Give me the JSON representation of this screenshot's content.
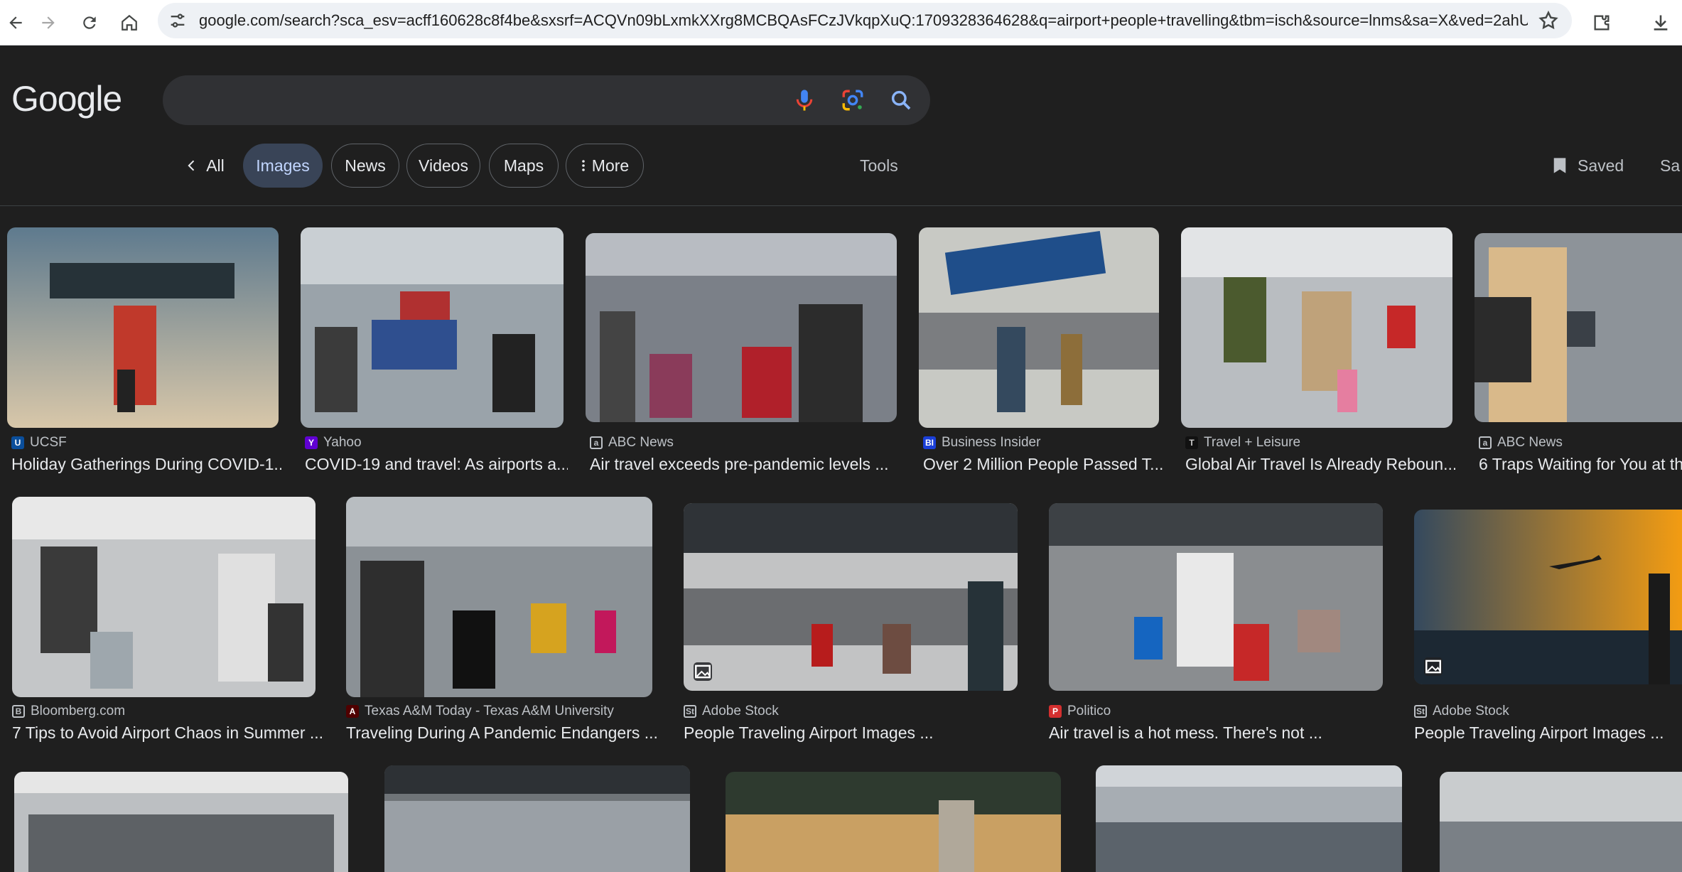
{
  "browser": {
    "url": "google.com/search?sca_esv=acff160628c8f4be&sxsrf=ACQVn09bLxmkXXrg8MCBQAsFCzJVkqpXuQ:1709328364628&q=airport+people+travelling&tbm=isch&source=lnms&sa=X&ved=2ahU..."
  },
  "header": {
    "logo": "Google",
    "search_value": ""
  },
  "tabs": {
    "all": "All",
    "images": "Images",
    "news": "News",
    "videos": "Videos",
    "maps": "Maps",
    "more": "More",
    "tools": "Tools",
    "saved": "Saved",
    "safesearch": "Sa"
  },
  "results": [
    {
      "source": "UCSF",
      "title": "Holiday Gatherings During COVID-1..."
    },
    {
      "source": "Yahoo",
      "title": "COVID-19 and travel: As airports a..."
    },
    {
      "source": "ABC News",
      "title": "Air travel exceeds pre-pandemic levels ..."
    },
    {
      "source": "Business Insider",
      "title": "Over 2 Million People Passed T..."
    },
    {
      "source": "Travel + Leisure",
      "title": "Global Air Travel Is Already Reboun..."
    },
    {
      "source": "ABC News",
      "title": "6 Traps Waiting for You at th"
    },
    {
      "source": "Bloomberg.com",
      "title": "7 Tips to Avoid Airport Chaos in Summer ..."
    },
    {
      "source": "Texas A&M Today - Texas A&M University",
      "title": "Traveling During A Pandemic Endangers ..."
    },
    {
      "source": "Adobe Stock",
      "title": "People Traveling Airport Images ..."
    },
    {
      "source": "Politico",
      "title": "Air travel is a hot mess. There's not ..."
    },
    {
      "source": "Adobe Stock",
      "title": "People Traveling Airport Images ..."
    }
  ],
  "colors": {
    "background": "#1f1f1f",
    "active_tab": "#394457",
    "text": "#e8eaed",
    "muted": "#bdc1c6"
  }
}
